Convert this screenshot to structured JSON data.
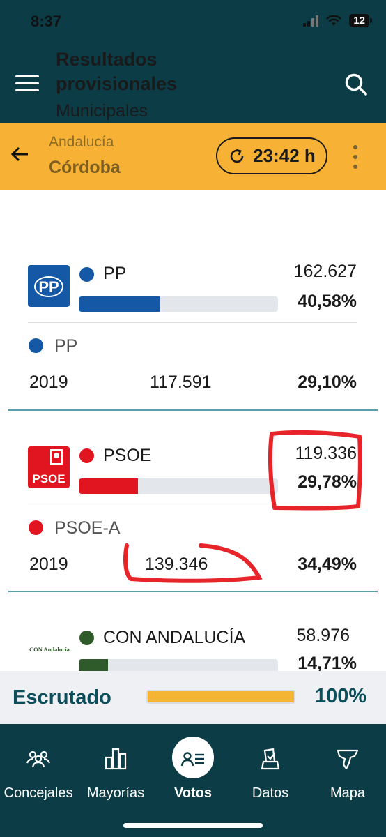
{
  "status": {
    "time": "8:37",
    "battery": "12"
  },
  "header": {
    "title": "Resultados provisionales",
    "subtitle": "Municipales"
  },
  "location": {
    "region": "Andalucía",
    "city": "Córdoba",
    "update_time": "23:42 h"
  },
  "colors": {
    "header_bg": "#0c3d47",
    "accent": "#f7b235",
    "pp": "#1458a6",
    "psoe": "#e0151f",
    "conandalucia": "#2f5a2a"
  },
  "parties": [
    {
      "name": "PP",
      "logo_text": "PP",
      "votes": "162.627",
      "percent": "40,58%",
      "bar_fraction": 0.4058,
      "previous": {
        "name": "PP",
        "year": "2019",
        "votes": "117.591",
        "percent": "29,10%"
      }
    },
    {
      "name": "PSOE",
      "logo_text": "PSOE",
      "votes": "119.336",
      "percent": "29,78%",
      "bar_fraction": 0.2978,
      "previous": {
        "name": "PSOE-A",
        "year": "2019",
        "votes": "139.346",
        "percent": "34,49%"
      }
    },
    {
      "name": "CON ANDALUCÍA",
      "logo_text": "CON Andalucía",
      "votes": "58.976",
      "percent": "14,71%",
      "bar_fraction": 0.1471
    }
  ],
  "scrutiny": {
    "label": "Escrutado",
    "percent": "100%",
    "fraction": 1.0
  },
  "nav": [
    {
      "label": "Concejales",
      "icon": "people-icon"
    },
    {
      "label": "Mayorías",
      "icon": "bar-chart-icon"
    },
    {
      "label": "Votos",
      "icon": "vote-card-icon",
      "active": true
    },
    {
      "label": "Datos",
      "icon": "ballot-icon"
    },
    {
      "label": "Mapa",
      "icon": "map-icon"
    }
  ]
}
